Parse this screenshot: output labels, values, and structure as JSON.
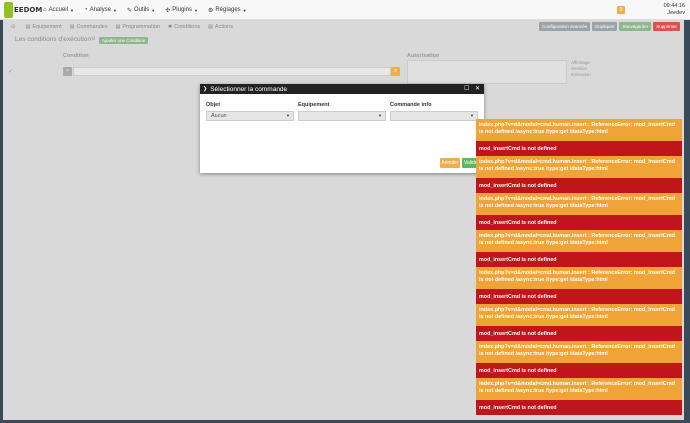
{
  "navbar": {
    "logo_text": "EEDOM",
    "menu": [
      {
        "icon": "⌂",
        "icon_name": "home-icon",
        "label": "Accueil"
      },
      {
        "icon": "◔",
        "icon_name": "analysis-icon",
        "label": "Analyse"
      },
      {
        "icon": "✎",
        "icon_name": "wrench-icon",
        "label": "Outils"
      },
      {
        "icon": "✣",
        "icon_name": "plugin-icon",
        "label": "Plugins"
      },
      {
        "icon": "⚙",
        "icon_name": "gear-icon",
        "label": "Réglages"
      }
    ],
    "notification_count": "0",
    "time": "09:44:16",
    "user": "Jeedev"
  },
  "page": {
    "tabs": [
      {
        "icon": "▤",
        "icon_name": "equipment-icon",
        "label": "Equipement"
      },
      {
        "icon": "▤",
        "icon_name": "commands-icon",
        "label": "Commandes"
      },
      {
        "icon": "▤",
        "icon_name": "schedule-icon",
        "label": "Programmation"
      },
      {
        "icon": "✱",
        "icon_name": "conditions-icon",
        "label": "Conditions"
      },
      {
        "icon": "▤",
        "icon_name": "actions-icon",
        "label": "Actions"
      }
    ],
    "buttons": {
      "advanced": "Configuration avancée",
      "duplicate": "Dupliquer",
      "save": "Sauvegarder",
      "delete": "Supprimer"
    },
    "section_title": "Les conditions d'exécution",
    "add_condition": "Ajouter une Condition",
    "columns": {
      "condition": "Condition",
      "autorisation": "Autorisation"
    },
    "autorisation_label": "Affichage Session Exécution"
  },
  "modal": {
    "title": "Sélectionner la commande",
    "fields": {
      "objet_label": "Objet",
      "objet_value": "Aucun",
      "equipement_label": "Equipement",
      "equipement_value": "",
      "commande_label": "Commande info",
      "commande_value": ""
    },
    "cancel": "Annuler",
    "validate": "Valider"
  },
  "notifications": [
    {
      "type": "warn",
      "text": "index.php?v=d&modal=cmd.human.insert : ReferenceError: mod_insertCmd is not defined /async:true /type:get /dataType:html"
    },
    {
      "type": "err",
      "text": "mod_insertCmd is not defined"
    },
    {
      "type": "warn",
      "text": "index.php?v=d&modal=cmd.human.insert : ReferenceError: mod_insertCmd is not defined /async:true /type:get /dataType:html"
    },
    {
      "type": "err",
      "text": "mod_insertCmd is not defined"
    },
    {
      "type": "warn",
      "text": "index.php?v=d&modal=cmd.human.insert : ReferenceError: mod_insertCmd is not defined /async:true /type:get /dataType:html"
    },
    {
      "type": "err",
      "text": "mod_insertCmd is not defined"
    },
    {
      "type": "warn",
      "text": "index.php?v=d&modal=cmd.human.insert : ReferenceError: mod_insertCmd is not defined /async:true /type:get /dataType:html"
    },
    {
      "type": "err",
      "text": "mod_insertCmd is not defined"
    },
    {
      "type": "warn",
      "text": "index.php?v=d&modal=cmd.human.insert : ReferenceError: mod_insertCmd is not defined /async:true /type:get /dataType:html"
    },
    {
      "type": "err",
      "text": "mod_insertCmd is not defined"
    },
    {
      "type": "warn",
      "text": "index.php?v=d&modal=cmd.human.insert : ReferenceError: mod_insertCmd is not defined /async:true /type:get /dataType:html"
    },
    {
      "type": "err",
      "text": "mod_insertCmd is not defined"
    },
    {
      "type": "warn",
      "text": "index.php?v=d&modal=cmd.human.insert : ReferenceError: mod_insertCmd is not defined /async:true /type:get /dataType:html"
    },
    {
      "type": "err",
      "text": "mod_insertCmd is not defined"
    },
    {
      "type": "warn",
      "text": "index.php?v=d&modal=cmd.human.insert : ReferenceError: mod_insertCmd is not defined /async:true /type:get /dataType:html"
    },
    {
      "type": "err",
      "text": "mod_insertCmd is not defined"
    }
  ]
}
